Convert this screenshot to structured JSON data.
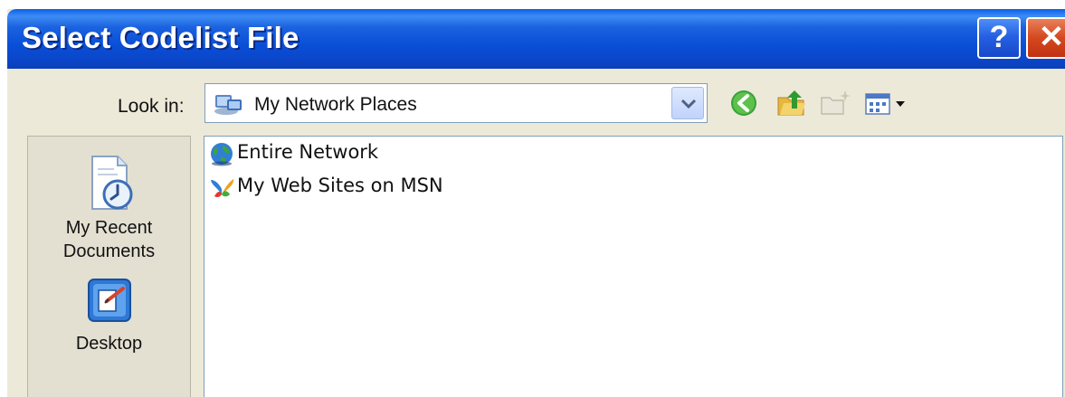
{
  "dialog": {
    "title": "Select Codelist File",
    "help_label": "?",
    "close_label": "✕"
  },
  "lookin": {
    "label": "Look in:",
    "value": "My Network Places",
    "icon": "network-places-icon"
  },
  "toolbar": {
    "icons": [
      "back-icon",
      "up-folder-icon",
      "new-folder-icon",
      "views-menu-icon"
    ]
  },
  "places_bar": {
    "items": [
      {
        "label": "My Recent\nDocuments",
        "icon": "recent-documents-icon"
      },
      {
        "label": "Desktop",
        "icon": "desktop-icon"
      }
    ]
  },
  "file_list": {
    "items": [
      {
        "label": "Entire Network",
        "icon": "globe-icon"
      },
      {
        "label": "My Web Sites on MSN",
        "icon": "msn-butterfly-icon"
      }
    ]
  },
  "colors": {
    "titlebar": "#0a4fd8",
    "dialog_background": "#ece9d8",
    "close_button": "#d4481f"
  }
}
